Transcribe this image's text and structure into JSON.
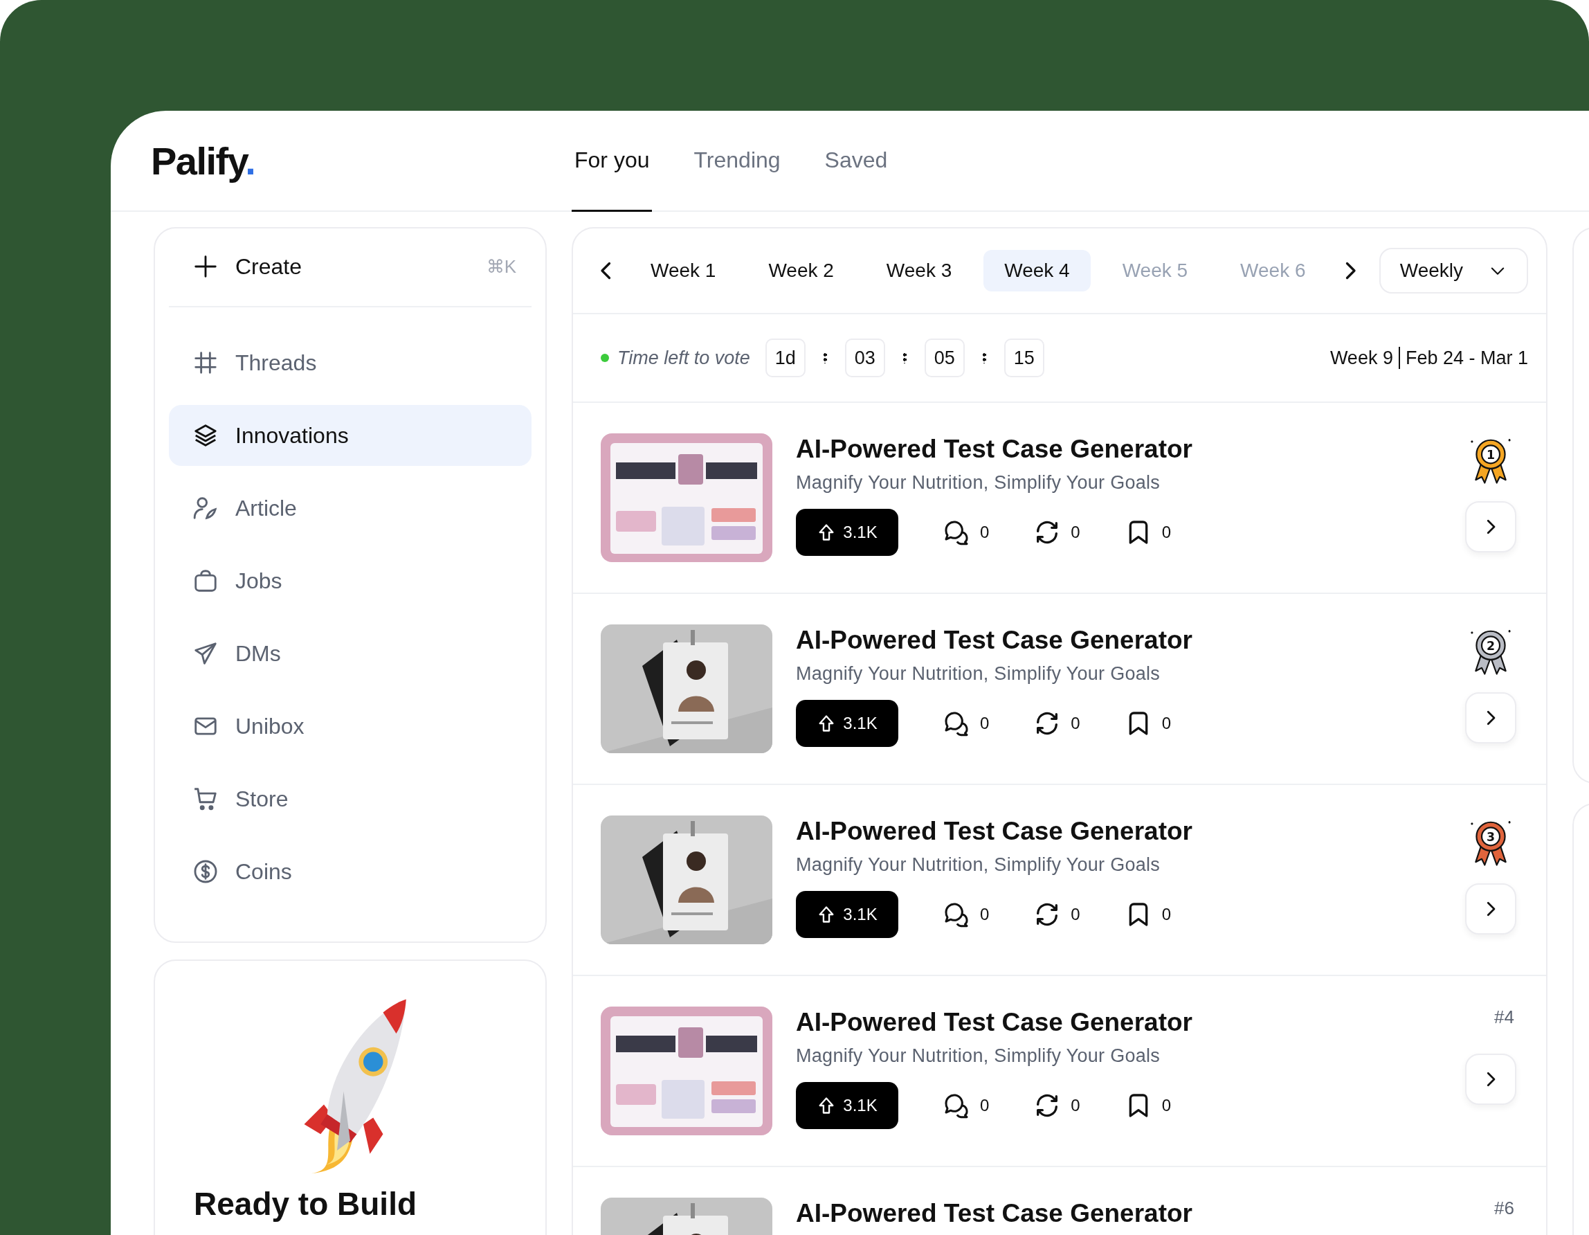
{
  "logo": {
    "name": "Palify",
    "dot": "."
  },
  "tabs": [
    {
      "label": "For you",
      "selected": true
    },
    {
      "label": "Trending",
      "selected": false
    },
    {
      "label": "Saved",
      "selected": false
    }
  ],
  "sidebar": {
    "create": {
      "label": "Create",
      "shortcut": "⌘K"
    },
    "items": [
      {
        "label": "Threads",
        "kind": "hash",
        "selected": false
      },
      {
        "label": "Innovations",
        "kind": "layers",
        "selected": true
      },
      {
        "label": "Article",
        "kind": "writer",
        "selected": false
      },
      {
        "label": "Jobs",
        "kind": "bag",
        "selected": false
      },
      {
        "label": "DMs",
        "kind": "send",
        "selected": false
      },
      {
        "label": "Unibox",
        "kind": "mail",
        "selected": false
      },
      {
        "label": "Store",
        "kind": "cart",
        "selected": false
      },
      {
        "label": "Coins",
        "kind": "coin",
        "selected": false
      }
    ]
  },
  "promo": {
    "title": "Ready to Build"
  },
  "weeks": [
    {
      "label": "Week 1",
      "selected": false,
      "disabled": false
    },
    {
      "label": "Week 2",
      "selected": false,
      "disabled": false
    },
    {
      "label": "Week 3",
      "selected": false,
      "disabled": false
    },
    {
      "label": "Week 4",
      "selected": true,
      "disabled": false
    },
    {
      "label": "Week 5",
      "selected": false,
      "disabled": true
    },
    {
      "label": "Week 6",
      "selected": false,
      "disabled": true
    }
  ],
  "period": {
    "value": "Weekly"
  },
  "vote": {
    "label": "Time left to vote",
    "color": "#3ccb3c",
    "timer": [
      "1d",
      "03",
      "05",
      "15"
    ],
    "week": "Week 9",
    "dates": "Feb 24 - Mar 1"
  },
  "posts": [
    {
      "title": "AI-Powered Test Case Generator",
      "subtitle": "Magnify Your Nutrition, Simplify Your Goals",
      "votes": "3.1K",
      "comments": "0",
      "reposts": "0",
      "saves": "0",
      "rank": {
        "kind": "medal",
        "label": "1",
        "color": "#f5a623"
      }
    },
    {
      "title": "AI-Powered Test Case Generator",
      "subtitle": "Magnify Your Nutrition, Simplify Your Goals",
      "votes": "3.1K",
      "comments": "0",
      "reposts": "0",
      "saves": "0",
      "rank": {
        "kind": "medal",
        "label": "2",
        "color": "#b9bcc4"
      }
    },
    {
      "title": "AI-Powered Test Case Generator",
      "subtitle": "Magnify Your Nutrition, Simplify Your Goals",
      "votes": "3.1K",
      "comments": "0",
      "reposts": "0",
      "saves": "0",
      "rank": {
        "kind": "medal",
        "label": "3",
        "color": "#e0643c"
      }
    },
    {
      "title": "AI-Powered Test Case Generator",
      "subtitle": "Magnify Your Nutrition, Simplify Your Goals",
      "votes": "3.1K",
      "comments": "0",
      "reposts": "0",
      "saves": "0",
      "rank": {
        "kind": "number",
        "label": "#4"
      }
    },
    {
      "title": "AI-Powered Test Case Generator",
      "rank": {
        "kind": "number",
        "label": "#6"
      }
    }
  ]
}
